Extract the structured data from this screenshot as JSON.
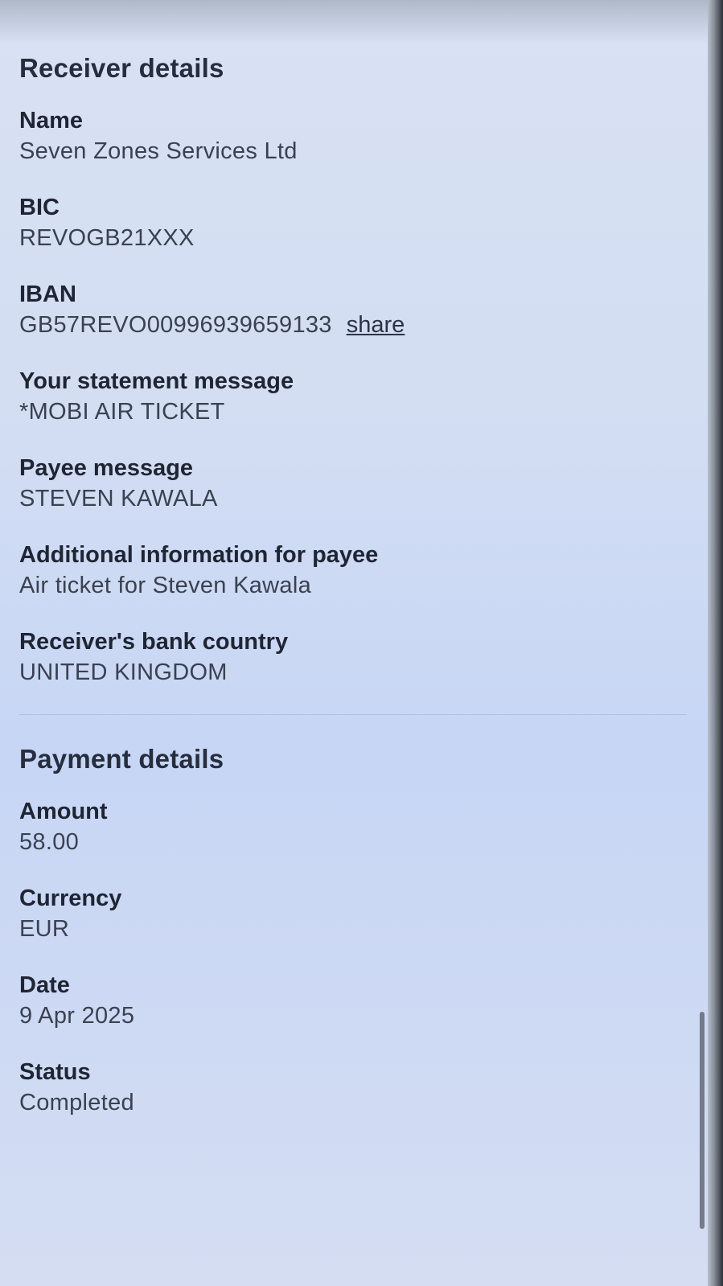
{
  "receiver": {
    "title": "Receiver details",
    "name_label": "Name",
    "name_value": "Seven Zones Services Ltd",
    "bic_label": "BIC",
    "bic_value": "REVOGB21XXX",
    "iban_label": "IBAN",
    "iban_value": "GB57REVO00996939659133",
    "share_label": "share",
    "statement_label": "Your statement message",
    "statement_value": "*MOBI AIR TICKET",
    "payee_msg_label": "Payee message",
    "payee_msg_value": "STEVEN KAWALA",
    "additional_label": "Additional information for payee",
    "additional_value": "Air ticket for Steven Kawala",
    "country_label": "Receiver's bank country",
    "country_value": "UNITED KINGDOM"
  },
  "payment": {
    "title": "Payment details",
    "amount_label": "Amount",
    "amount_value": "58.00",
    "currency_label": "Currency",
    "currency_value": "EUR",
    "date_label": "Date",
    "date_value": "9 Apr 2025",
    "status_label": "Status",
    "status_value": "Completed"
  }
}
